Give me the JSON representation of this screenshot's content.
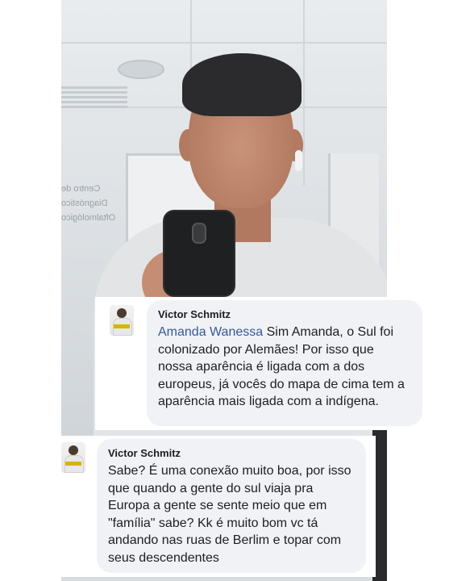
{
  "comments": [
    {
      "author": "Victor Schmitz",
      "mention": "Amanda Wanessa",
      "text": "Sim Amanda, o Sul foi colonizado por Alemães! Por isso que nossa aparência é ligada com a dos europeus, já vocês do mapa de cima tem a aparência mais ligada com a indígena."
    },
    {
      "author": "Victor Schmitz",
      "text": "Sabe? É uma conexão muito boa, por isso que quando a gente do sul viaja pra Europa a gente se sente meio que em \"família\" sabe? Kk é muito bom vc tá andando nas ruas de Berlim e topar com seus descendentes"
    }
  ],
  "photo": {
    "wall_text": "Centro de Diagnóstico Oftalmológico"
  },
  "colors": {
    "bubble_bg": "#f0f2f5",
    "mention": "#385898",
    "text": "#1c1e21"
  }
}
